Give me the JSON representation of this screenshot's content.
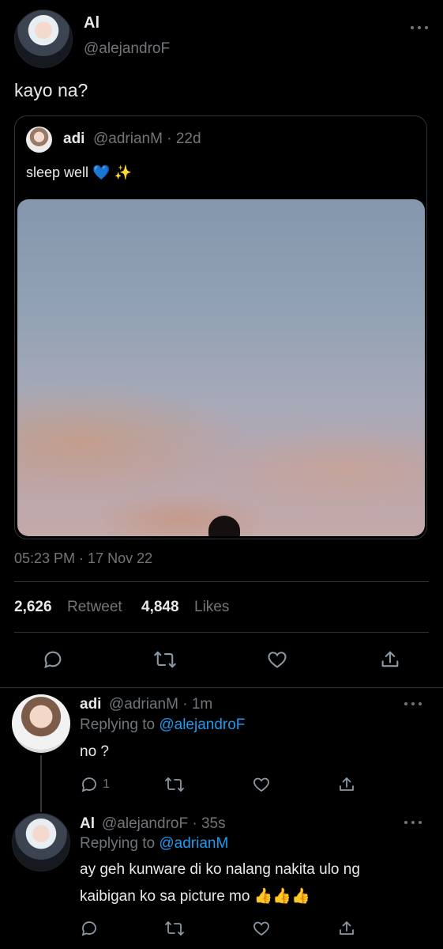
{
  "main_tweet": {
    "name": "Al",
    "handle": "@alejandroF",
    "text": "kayo na?",
    "timestamp": "05:23 PM · 17 Nov 22",
    "retweets_count": "2,626",
    "retweets_label": "Retweet",
    "likes_count": "4,848",
    "likes_label": "Likes"
  },
  "quoted_tweet": {
    "name": "adi",
    "handle_time": "@adrianM · 22d",
    "text": "sleep well 💙 ✨"
  },
  "replies": [
    {
      "name": "adi",
      "handle_time": "@adrianM · 1m",
      "replying_prefix": "Replying to",
      "replying_to": "@alejandroF",
      "text": "no ?",
      "reply_count": "1"
    },
    {
      "name": "Al",
      "handle_time": "@alejandroF · 35s",
      "replying_prefix": "Replying to",
      "replying_to": "@adrianM",
      "text_line1": "ay geh kunware di ko nalang nakita ulo ng",
      "text_line2": "kaibigan ko sa picture mo 👍👍👍"
    }
  ],
  "icons": [
    "more-icon",
    "reply-icon",
    "retweet-icon",
    "like-icon",
    "share-icon"
  ],
  "colors": {
    "background": "#000000",
    "text": "#e7e9ea",
    "muted": "#71767b",
    "link": "#1d9bf0",
    "border": "#2f3336"
  }
}
